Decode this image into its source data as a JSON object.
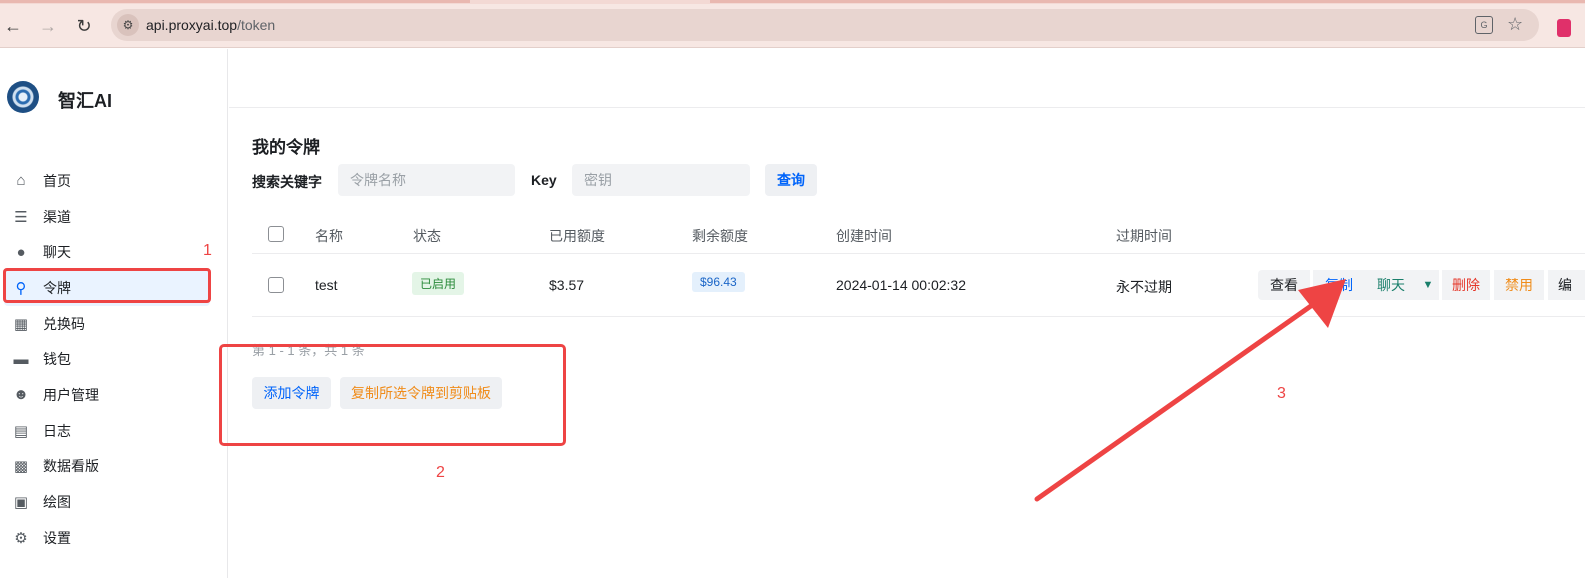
{
  "browser": {
    "url_host": "api.proxyai.top",
    "url_path": "/token"
  },
  "sidebar": {
    "brand": "智汇AI",
    "items": [
      {
        "label": "首页",
        "icon": "home-icon"
      },
      {
        "label": "渠道",
        "icon": "layers-icon"
      },
      {
        "label": "聊天",
        "icon": "chat-icon"
      },
      {
        "label": "令牌",
        "icon": "key-icon",
        "active": true
      },
      {
        "label": "兑换码",
        "icon": "gift-icon"
      },
      {
        "label": "钱包",
        "icon": "wallet-icon"
      },
      {
        "label": "用户管理",
        "icon": "user-icon"
      },
      {
        "label": "日志",
        "icon": "bar-chart-icon"
      },
      {
        "label": "数据看版",
        "icon": "dashboard-icon"
      },
      {
        "label": "绘图",
        "icon": "image-icon"
      },
      {
        "label": "设置",
        "icon": "gear-icon"
      }
    ]
  },
  "main": {
    "title": "我的令牌",
    "search_label": "搜索关键字",
    "name_placeholder": "令牌名称",
    "key_label": "Key",
    "key_placeholder": "密钥",
    "query_label": "查询",
    "columns": [
      "名称",
      "状态",
      "已用额度",
      "剩余额度",
      "创建时间",
      "过期时间"
    ],
    "row": {
      "name": "test",
      "status": "已启用",
      "used": "$3.57",
      "remaining": "$96.43",
      "created": "2024-01-14 00:02:32",
      "expires": "永不过期"
    },
    "actions": {
      "view": "查看",
      "copy": "复制",
      "chat": "聊天",
      "delete": "删除",
      "disable": "禁用",
      "edit": "编"
    },
    "pager": "第 1 - 1 条，共 1 条",
    "add_label": "添加令牌",
    "copy_selected_label": "复制所选令牌到剪贴板"
  },
  "annotations": {
    "n1": "1",
    "n2": "2",
    "n3": "3",
    "color": "#ee4444"
  }
}
